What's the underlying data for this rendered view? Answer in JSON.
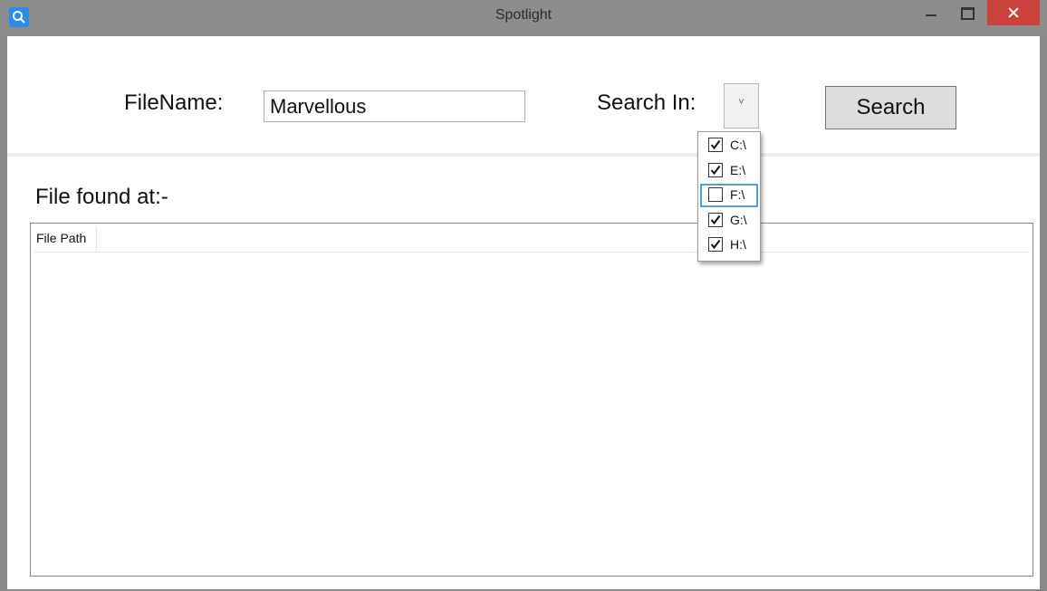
{
  "window": {
    "title": "Spotlight",
    "icon": "search-icon"
  },
  "form": {
    "filename_label": "FileName:",
    "filename_value": "Marvellous",
    "search_in_label": "Search In:",
    "dropdown_glyph": "˅",
    "search_button": "Search"
  },
  "results": {
    "label": "File found at:-",
    "columns": [
      "File Path"
    ]
  },
  "drives": [
    {
      "label": "C:\\",
      "checked": true
    },
    {
      "label": "E:\\",
      "checked": true
    },
    {
      "label": "F:\\",
      "checked": false
    },
    {
      "label": "G:\\",
      "checked": true
    },
    {
      "label": "H:\\",
      "checked": true
    }
  ],
  "colors": {
    "close_button": "#c9423b",
    "titlebar": "#8d8d8d",
    "focus_border": "#4aa3d8"
  }
}
